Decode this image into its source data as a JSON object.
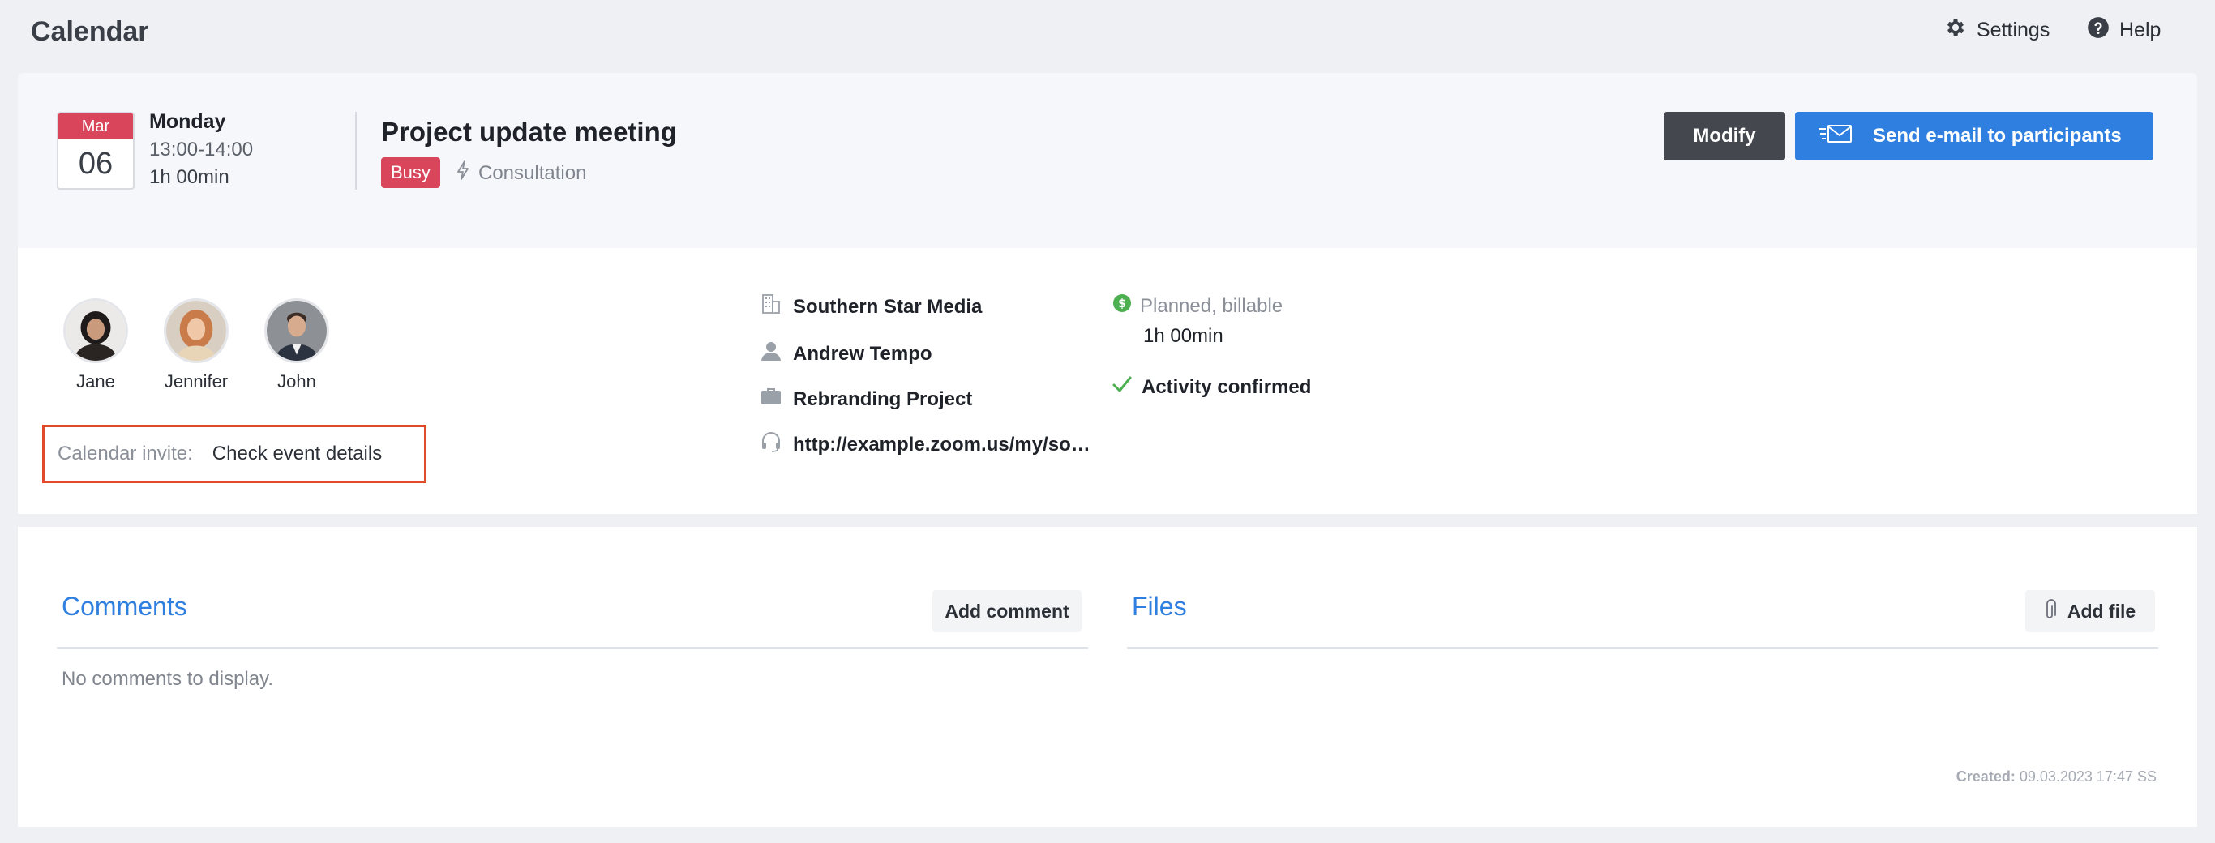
{
  "app": {
    "title": "Calendar"
  },
  "topbar": {
    "settings_label": "Settings",
    "help_label": "Help"
  },
  "event": {
    "month": "Mar",
    "day": "06",
    "weekday": "Monday",
    "time_range": "13:00-14:00",
    "duration": "1h 00min",
    "title": "Project update meeting",
    "status_badge": "Busy",
    "type": "Consultation"
  },
  "actions": {
    "modify_label": "Modify",
    "email_label": "Send e-mail to participants"
  },
  "participants": [
    {
      "name": "Jane"
    },
    {
      "name": "Jennifer"
    },
    {
      "name": "John"
    }
  ],
  "invite": {
    "label": "Calendar invite:",
    "link": "Check event details"
  },
  "details": {
    "company": "Southern Star Media",
    "contact": "Andrew Tempo",
    "project": "Rebranding Project",
    "url": "http://example.zoom.us/my/southernstarmedia"
  },
  "billing": {
    "status": "Planned, billable",
    "duration": "1h 00min",
    "confirmation": "Activity confirmed"
  },
  "comments": {
    "title": "Comments",
    "add_label": "Add comment",
    "empty_text": "No comments to display."
  },
  "files": {
    "title": "Files",
    "add_label": "Add file"
  },
  "footer": {
    "created_label": "Created:",
    "created_value": "09.03.2023 17:47 SS"
  },
  "colors": {
    "accent": "#2f7fe0",
    "busy": "#d9455b",
    "dark_button": "#44474d",
    "billable": "#4caf50",
    "highlight_border": "#e24a2b"
  }
}
